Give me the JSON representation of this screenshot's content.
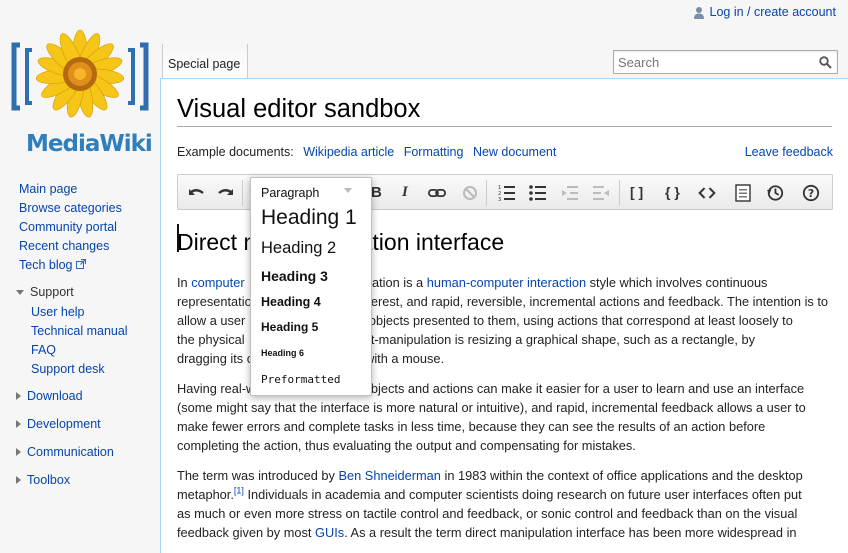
{
  "personal": {
    "login": "Log in / create account"
  },
  "logo": {
    "text": "MediaWiki"
  },
  "sidebar": {
    "nav": [
      "Main page",
      "Browse categories",
      "Community portal",
      "Recent changes",
      "Tech blog"
    ],
    "support": {
      "title": "Support",
      "items": [
        "User help",
        "Technical manual",
        "FAQ",
        "Support desk"
      ]
    },
    "collapsed": [
      "Download",
      "Development",
      "Communication",
      "Toolbox"
    ]
  },
  "tabs": {
    "special": "Special page"
  },
  "search": {
    "placeholder": "Search"
  },
  "page": {
    "title": "Visual editor sandbox",
    "examples_label": "Example documents:",
    "examples": [
      "Wikipedia article",
      "Formatting",
      "New document"
    ],
    "feedback": "Leave feedback"
  },
  "toolbar": {
    "bold": "B",
    "italic": "I",
    "brackets": "[ ]",
    "braces": "{ }"
  },
  "format_menu": {
    "options": [
      "Paragraph",
      "Heading 1",
      "Heading 2",
      "Heading 3",
      "Heading 4",
      "Heading 5",
      "Heading 6",
      "Preformatted"
    ]
  },
  "document": {
    "heading_start": "Direct m",
    "heading_end": "ation interface",
    "p1": {
      "s1": "In ",
      "link1": "computer",
      "s2": " manipulation is a ",
      "link2": "human-computer interaction",
      "s3": " style which involves continuous",
      "line2": "representation",
      "line2b": " interest, and rapid, reversible, incremental actions and feedback. The intention is to",
      "line3": "allow a user",
      "line3b": " objects presented to them, using actions that correspond at least loosely to",
      "line4": "the physical",
      "line4b": " direct-manipulation is resizing a graphical shape, such as a rectangle, by",
      "line5": "dragging its c",
      "line5b": " edges with a mouse."
    },
    "p2": {
      "l1a": "Having real-w",
      "l1b": " objects and actions can make it easier for a user to learn and use an interface",
      "l2": "(some might say that the interface is more natural or intuitive), and rapid, incremental feedback allows a user to",
      "l3": "make fewer errors and complete tasks in less time, because they can see the results of an action before",
      "l4": "completing the action, thus evaluating the output and compensating for mistakes."
    },
    "p3": {
      "a": "The term was introduced by ",
      "link": "Ben Shneiderman",
      "b": " in 1983 within the context of office applications and the desktop",
      "c": "metaphor.",
      "ref": "[1]",
      "d": " Individuals in academia and computer scientists doing research on future user interfaces often put",
      "e": "as much or even more stress on tactile control and feedback, or sonic control and feedback than on the visual",
      "f": "feedback given by most ",
      "link2": "GUIs",
      "g": ". As a result the term direct manipulation interface has been more widespread in"
    }
  },
  "colors": {
    "link": "#0645ad",
    "logo_blue": "#2f7fbd",
    "border_blue": "#a7d7f9"
  }
}
